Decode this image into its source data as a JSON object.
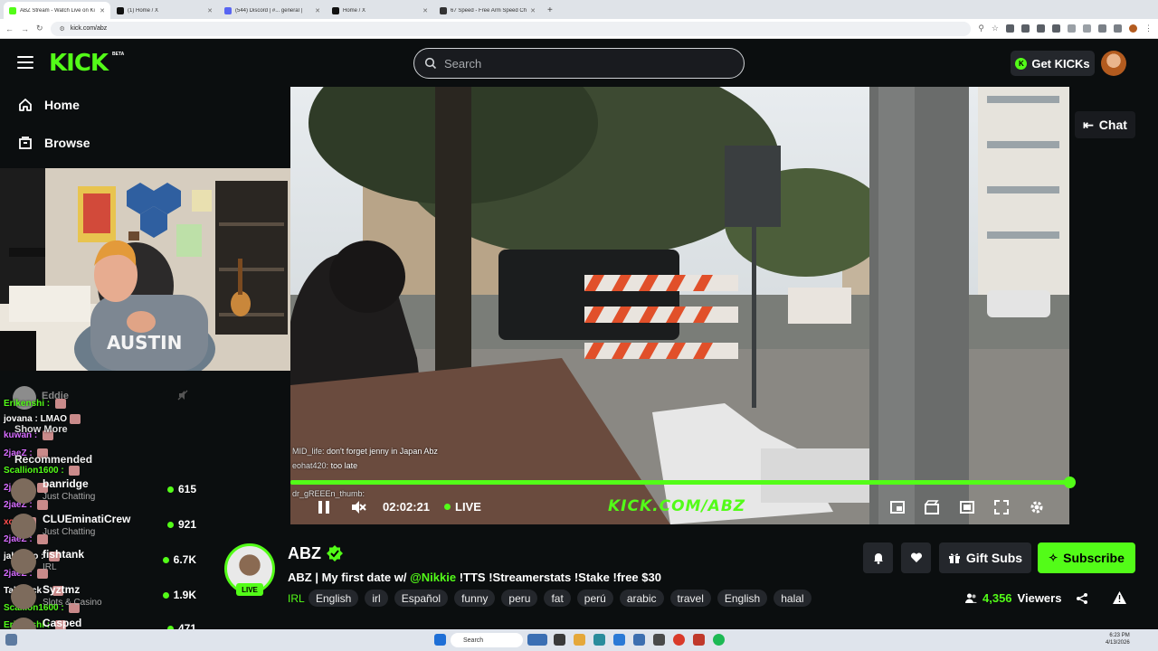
{
  "browser": {
    "tabs": [
      {
        "title": "ABZ Stream - Watch Live on Ki",
        "color": "#53fc18",
        "active": true
      },
      {
        "title": "(1) Home / X",
        "color": "#111111",
        "active": false
      },
      {
        "title": "(544) Discord | #... general |",
        "color": "#5865f2",
        "active": false
      },
      {
        "title": "Home / X",
        "color": "#111111",
        "active": false
      },
      {
        "title": "67 Speed - Free Arm Speed Ch",
        "color": "#333333",
        "active": false
      }
    ],
    "url": "kick.com/abz"
  },
  "header": {
    "logo": "KICK",
    "beta": "BETA",
    "search_placeholder": "Search",
    "get_kicks": "Get KICKs",
    "accent": "#53fc18"
  },
  "sidebar": {
    "home": "Home",
    "browse": "Browse",
    "show_more": "Show More",
    "recommended": "Recommended",
    "items": [
      {
        "name": "banridge",
        "category": "Just Chatting",
        "viewers": "615"
      },
      {
        "name": "CLUEminatiCrew",
        "category": "Just Chatting",
        "viewers": "921"
      },
      {
        "name": "fishtank",
        "category": "IRL",
        "viewers": "6.7K"
      },
      {
        "name": "Syztmz",
        "category": "Slots & Casino",
        "viewers": "1.9K"
      },
      {
        "name": "Casped",
        "category": "",
        "viewers": "471"
      }
    ]
  },
  "overlay_chat": [
    {
      "user": "Erikenshi :",
      "msg": "",
      "color": "#53fc18"
    },
    {
      "user": "jovana :",
      "msg": "LMAO",
      "color": "#ffffff"
    },
    {
      "user": "kuwan :",
      "msg": "",
      "color": "#d66cff"
    },
    {
      "user": "2jaeZ :",
      "msg": "",
      "color": "#d66cff"
    },
    {
      "user": "Scallion1600 :",
      "msg": "",
      "color": "#53fc18"
    },
    {
      "user": "2jaeZ :",
      "msg": "",
      "color": "#d66cff"
    },
    {
      "user": "2jaeZ :",
      "msg": "",
      "color": "#d66cff"
    },
    {
      "user": "xo :",
      "msg": "",
      "color": "#ff4d4d"
    },
    {
      "user": "2jaeZ :",
      "msg": "",
      "color": "#d66cff"
    },
    {
      "user": "jakubdo :",
      "msg": "",
      "color": "#ffffff"
    },
    {
      "user": "2jaeZ :",
      "msg": "",
      "color": "#d66cff"
    },
    {
      "user": "Tallstack :",
      "msg": "",
      "color": "#ffffff"
    },
    {
      "user": "Scallion1600 :",
      "msg": "",
      "color": "#53fc18"
    },
    {
      "user": "Erikenshi :",
      "msg": "",
      "color": "#53fc18"
    }
  ],
  "overlay_extra": {
    "eddie": "Eddie",
    "bottom": "Scallion1600 :"
  },
  "video": {
    "chat_lines": [
      {
        "user": "MID_life:",
        "msg": "don't forget jenny in Japan Abz"
      },
      {
        "user": "eohat420:",
        "msg": "too late"
      },
      {
        "user": "dr_gREEEn_thumb:",
        "msg": ""
      }
    ],
    "watermark": "KICK.COM/ABZ",
    "time": "02:02:21",
    "live": "LIVE",
    "progress": 1.0
  },
  "chat_button": "Chat",
  "stream": {
    "channel": "ABZ",
    "live_badge": "LIVE",
    "title_pre": "ABZ | My first date w/ ",
    "title_mention": "@Nikkie",
    "title_post": " !TTS !Streamerstats !Stake !free $30",
    "category": "IRL",
    "tags": [
      "English",
      "irl",
      "Español",
      "funny",
      "peru",
      "fat",
      "perú",
      "arabic",
      "travel",
      "English",
      "halal"
    ],
    "viewers_count": "4,356",
    "viewers_label": "Viewers",
    "gift_subs": "Gift Subs",
    "subscribe": "Subscribe"
  },
  "taskbar": {
    "search": "Search",
    "time": "6:23 PM",
    "date": "4/13/2026"
  }
}
